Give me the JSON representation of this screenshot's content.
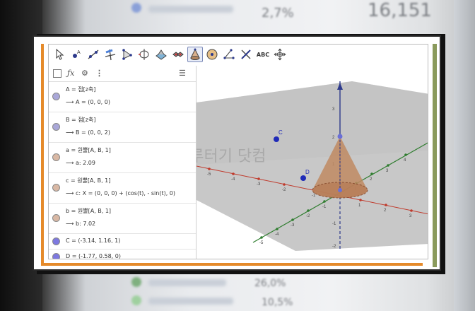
{
  "background": {
    "top_number": "16,151",
    "top_number_small": "2,7%",
    "bottom_a": "26,0%",
    "bottom_b": "10,5%"
  },
  "toolbar": {
    "tools": [
      {
        "name": "move-tool-icon",
        "icon": "cursor"
      },
      {
        "name": "point-tool-icon",
        "icon": "point"
      },
      {
        "name": "line-tool-icon",
        "icon": "line"
      },
      {
        "name": "perpendicular-tool-icon",
        "icon": "perp"
      },
      {
        "name": "polygon-tool-icon",
        "icon": "polygon"
      },
      {
        "name": "circle-axis-tool-icon",
        "icon": "circle-axis"
      },
      {
        "name": "plane-tool-icon",
        "icon": "plane"
      },
      {
        "name": "net-tool-icon",
        "icon": "net"
      },
      {
        "name": "cone-tool-icon",
        "icon": "cone"
      },
      {
        "name": "sphere-tool-icon",
        "icon": "sphere"
      },
      {
        "name": "angle-tool-icon",
        "icon": "angle"
      },
      {
        "name": "reflect-tool-icon",
        "icon": "reflect"
      },
      {
        "name": "text-tool-icon",
        "icon": "text",
        "label": "ABC"
      },
      {
        "name": "view-tool-icon",
        "icon": "view"
      }
    ]
  },
  "algebra": {
    "rows": [
      {
        "color": "#a9a7d8",
        "def": "A = 점[z축]",
        "val": "⟶   A = (0, 0, 0)"
      },
      {
        "color": "#a9a7d8",
        "def": "B = 점[z축]",
        "val": "⟶   B = (0, 0, 2)"
      },
      {
        "color": "#d9b8a4",
        "def": "a = 원뿔[A, B, 1]",
        "val": "⟶   a: 2.09"
      },
      {
        "color": "#d9b8a4",
        "def": "c = 원뿔[A, B, 1]",
        "val": "⟶   c: X = (0, 0, 0) + (cos(t), - sin(t), 0)"
      },
      {
        "color": "#d9b8a4",
        "def": "b = 원뿔[A, B, 1]",
        "val": "⟶   b: 7.02"
      },
      {
        "color": "#7d78e0",
        "single": "C = (-3.14, 1.16, 1)"
      },
      {
        "color": "#7d78e0",
        "single": "D = (-1.77, 0.58, 0)"
      }
    ]
  },
  "view3d": {
    "watermark": "그루터기 닷컴",
    "point_c": "C",
    "point_d": "D",
    "z_ticks": [
      "3",
      "2",
      "1",
      "-1",
      "-2"
    ],
    "x_ticks": [
      "-5",
      "-4",
      "-3",
      "-2",
      "-1",
      "1",
      "2",
      "3"
    ],
    "y_ticks": [
      "-5",
      "-4",
      "-3",
      "-2",
      "-1",
      "1",
      "2",
      "3",
      "4"
    ]
  }
}
